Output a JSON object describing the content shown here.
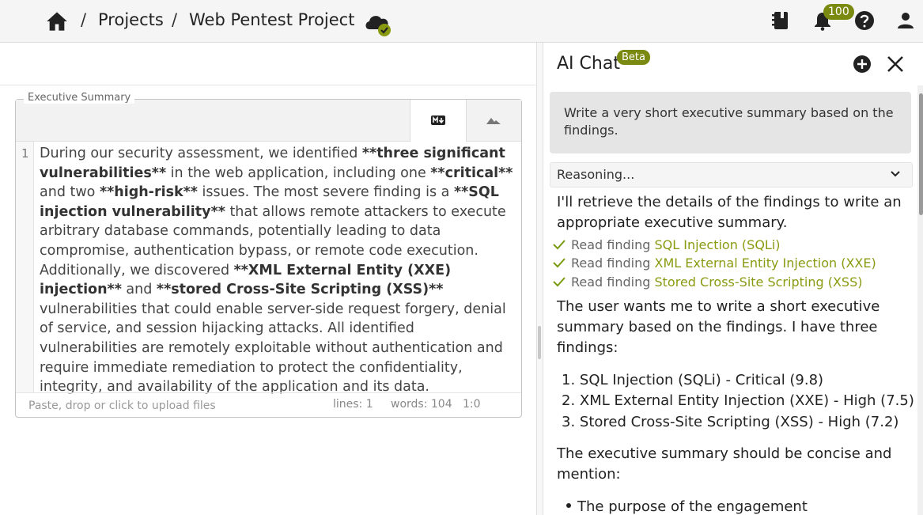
{
  "header": {
    "breadcrumb": [
      "Projects",
      "Web Pentest Project"
    ],
    "notification_count": "100",
    "icons": [
      "home-icon",
      "cloud-sync-check-icon",
      "notebook-icon",
      "bell-icon",
      "help-icon",
      "account-icon"
    ]
  },
  "editor": {
    "legend": "Executive Summary",
    "tabs": [
      "markdown-icon",
      "preview-image-icon"
    ],
    "line_number": "1",
    "segments": [
      {
        "t": "During our security assessment, we identified ",
        "b": false
      },
      {
        "t": "**three significant vulnerabilities**",
        "b": true
      },
      {
        "t": " in the web application, including one ",
        "b": false
      },
      {
        "t": "**critical**",
        "b": true
      },
      {
        "t": " and two ",
        "b": false
      },
      {
        "t": "**high-risk**",
        "b": true
      },
      {
        "t": " issues. The most severe finding is a ",
        "b": false
      },
      {
        "t": "**SQL injection vulnerability**",
        "b": true
      },
      {
        "t": " that allows remote attackers to execute arbitrary database commands, potentially leading to data compromise, authentication bypass, or remote code execution. Additionally, we discovered ",
        "b": false
      },
      {
        "t": "**XML External Entity (XXE) injection**",
        "b": true
      },
      {
        "t": " and ",
        "b": false
      },
      {
        "t": "**stored Cross-Site Scripting (XSS)**",
        "b": true
      },
      {
        "t": " vulnerabilities that could enable server-side request forgery, denial of service, and session hijacking attacks. All identified vulnerabilities are remotely exploitable without authentication and require immediate remediation to protect the confidentiality, integrity, and availability of the application and its data.",
        "b": false
      }
    ],
    "upload_hint": "Paste, drop or click to upload files",
    "lines_stat": "lines: 1",
    "words_stat": "words: 104",
    "cursor_stat": "1:0"
  },
  "chat": {
    "title": "AI Chat",
    "beta": "Beta",
    "user_message": "Write a very short executive summary based on the findings.",
    "reasoning_label": "Reasoning...",
    "intro": "I'll retrieve the details of the findings to write an appropriate executive summary.",
    "tool_prefix": "Read finding",
    "tool_calls": [
      "SQL Injection (SQLi)",
      "XML External Entity Injection (XXE)",
      "Stored Cross-Site Scripting (XSS)"
    ],
    "para1": "The user wants me to write a short executive summary based on the findings. I have three findings:",
    "findings": [
      "1. SQL Injection (SQLi) - Critical (9.8)",
      "2. XML External Entity Injection (XXE) - High (7.5)",
      "3. Stored Cross-Site Scripting (XSS) - High (7.2)"
    ],
    "para2": "The executive summary should be concise and mention:",
    "bullets": [
      "The purpose of the engagement"
    ]
  },
  "colors": {
    "accent": "#7a8a10",
    "link": "#8a9a10",
    "check": "#7a9a10"
  }
}
